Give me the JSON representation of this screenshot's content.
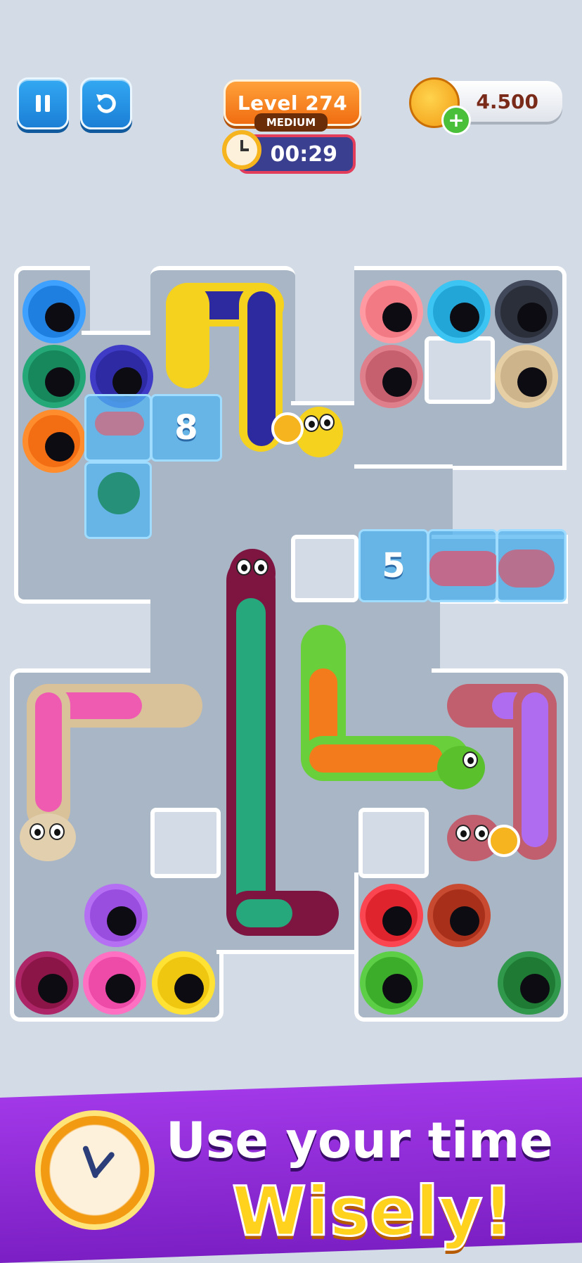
{
  "hud": {
    "pause_icon": "pause-icon",
    "restart_icon": "restart-icon",
    "level_label": "Level 274",
    "difficulty": "MEDIUM",
    "timer": "00:29",
    "coins": "4.500",
    "add_coins_label": "+"
  },
  "ice_blocks": {
    "left_count": "8",
    "right_count": "5"
  },
  "banner": {
    "line1": "Use your time",
    "line2": "Wisely!"
  },
  "colors": {
    "background": "#d3dce6",
    "board": "#a8b6c6",
    "accent_orange": "#f06d10",
    "timer_border": "#e23d5a",
    "banner_purple": "#a238e8"
  }
}
